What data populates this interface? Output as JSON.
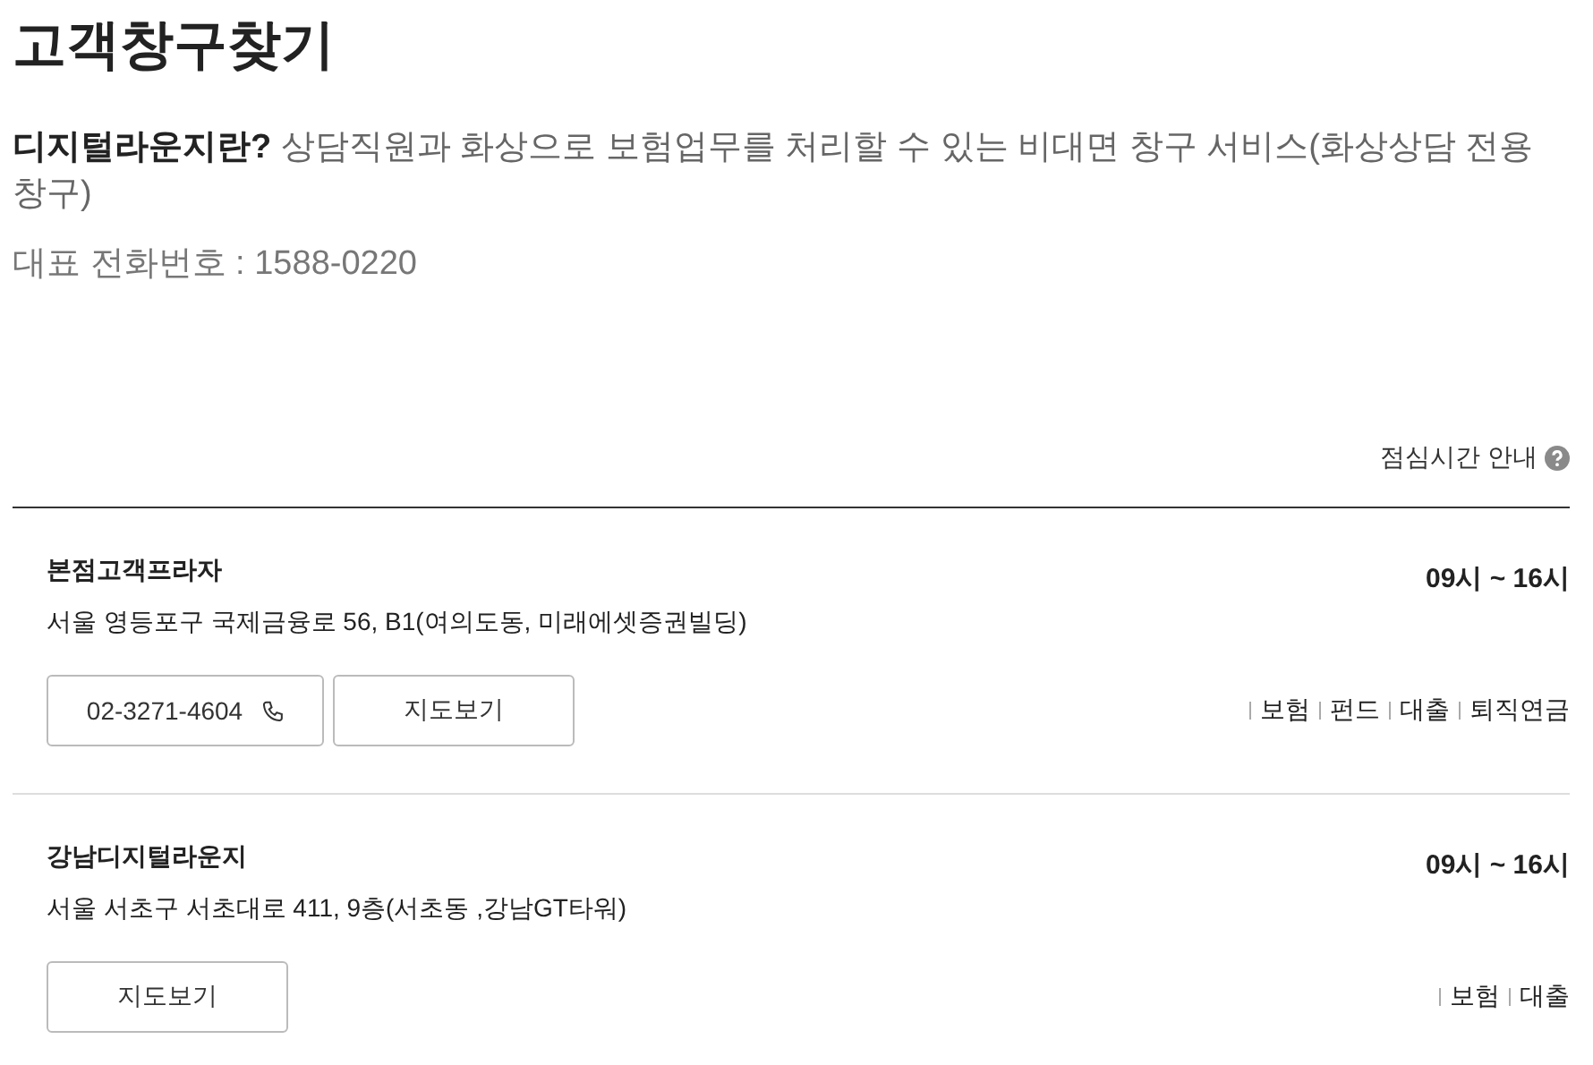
{
  "title": "고객창구찾기",
  "intro": {
    "term": "디지털라운지란?",
    "description": "상담직원과 화상으로 보험업무를 처리할 수 있는 비대면 창구 서비스(화상상담 전용 창구)"
  },
  "main_phone": "대표 전화번호 : 1588-0220",
  "lunch_link": "점심시간 안내",
  "branches": [
    {
      "name": "본점고객프라자",
      "hours": "09시 ~ 16시",
      "address": "서울 영등포구 국제금융로 56, B1(여의도동, 미래에셋증권빌딩)",
      "phone": "02-3271-4604",
      "map_button": "지도보기",
      "services": [
        "보험",
        "펀드",
        "대출",
        "퇴직연금"
      ]
    },
    {
      "name": "강남디지털라운지",
      "hours": "09시 ~ 16시",
      "address": "서울 서초구 서초대로 411, 9층(서초동 ,강남GT타워)",
      "map_button": "지도보기",
      "services": [
        "보험",
        "대출"
      ]
    }
  ]
}
